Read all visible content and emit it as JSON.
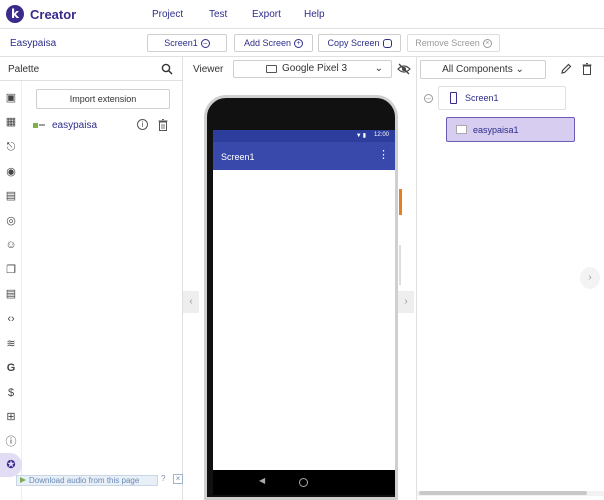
{
  "app": {
    "logo_letter": "k",
    "name": "Creator"
  },
  "menu": {
    "items": [
      {
        "label": "Project"
      },
      {
        "label": "Test"
      },
      {
        "label": "Export"
      },
      {
        "label": "Help"
      }
    ]
  },
  "toolbar": {
    "project_name": "Easypaisa",
    "screen_select_label": "Screen1",
    "add_screen_label": "Add Screen",
    "copy_screen_label": "Copy Screen",
    "remove_screen_label": "Remove Screen"
  },
  "palette": {
    "title": "Palette",
    "import_label": "Import extension",
    "extension": {
      "name": "easypaisa",
      "info_glyph": "i"
    },
    "strip_icons": [
      "user-interface-icon",
      "layout-icon",
      "media-icon",
      "drawing-animation-icon",
      "maps-icon",
      "sensors-icon",
      "social-icon",
      "storage-icon",
      "connectivity-icon",
      "lego-icon",
      "extensions-code-icon",
      "feed-icon",
      "google-icon",
      "monetization-icon",
      "dynamic-components-icon",
      "utilities-icon",
      "extension-puzzle-icon"
    ]
  },
  "viewer": {
    "label": "Viewer",
    "device": "Google Pixel 3",
    "screen": {
      "title": "Screen1",
      "time": "12:00"
    }
  },
  "components": {
    "filter_label": "All Components",
    "tree": {
      "root": "Screen1",
      "children": [
        "easypaisa1"
      ]
    }
  },
  "overlay": {
    "download_label": "Download audio from this page",
    "help_glyph": "?",
    "close_glyph": "×"
  },
  "colors": {
    "brand": "#3a2a8c",
    "app_bar": "#3949ab",
    "status_bar": "#2c3d9e",
    "selected_node": "#d6cdf0"
  }
}
